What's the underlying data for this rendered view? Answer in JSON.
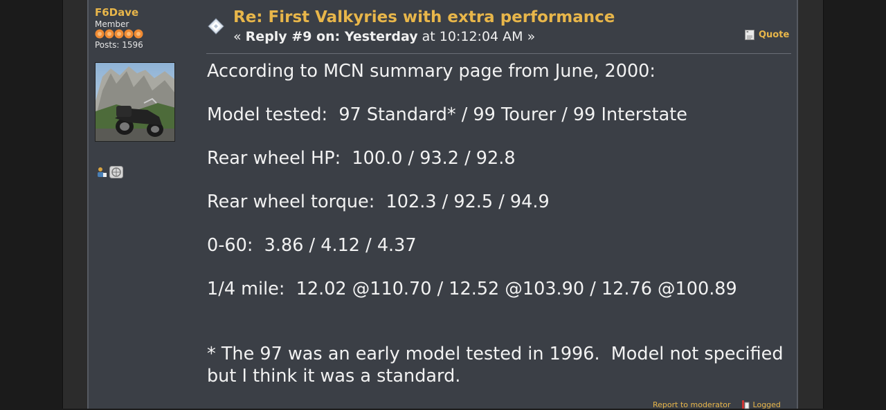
{
  "poster": {
    "name": "F6Dave",
    "group": "Member",
    "posts": "Posts: 1596",
    "stars": 5,
    "star_color": "#f08a32"
  },
  "post": {
    "subject": "Re: First Valkyries with extra performance",
    "reply_prefix": "« ",
    "reply_bold": "Reply #9 on: Yesterday",
    "reply_suffix": " at 10:12:04 AM »",
    "quote_label": "Quote",
    "body": {
      "line1": "According to MCN summary page from June, 2000:",
      "line2": "Model tested:  97 Standard* / 99 Tourer / 99 Interstate",
      "line3": "Rear wheel HP:  100.0 / 93.2 / 92.8",
      "line4": "Rear wheel torque:  102.3 / 92.5 / 94.9",
      "line5": "0-60:  3.86 / 4.12 / 4.37",
      "line6": "1/4 mile:  12.02 @110.70 / 12.52 @103.90 / 12.76 @100.89",
      "line7": "* The 97 was an early model tested in 1996.  Model not specified",
      "line8": "but I think it was a standard."
    },
    "report_label": "Report to moderator",
    "logged_label": "Logged"
  },
  "colors": {
    "accent": "#e8b64a",
    "panel": "#3b3f46",
    "text": "#f2f2f2"
  }
}
